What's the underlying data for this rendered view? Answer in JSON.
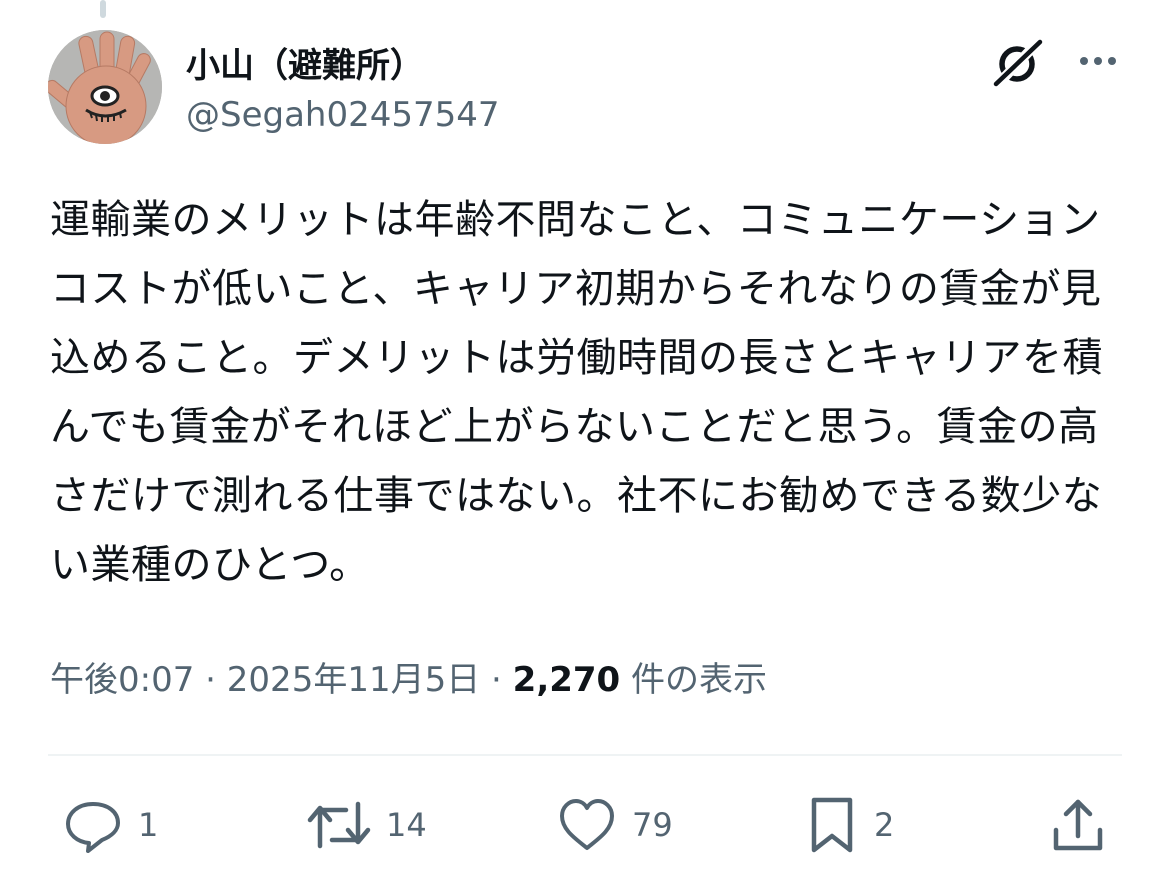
{
  "author": {
    "display_name": "小山（避難所）",
    "handle": "@Segah02457547"
  },
  "tweet": {
    "text": "運輸業のメリットは年齢不問なこと、コミュニケーションコストが低いこと、キャリア初期からそれなりの賃金が見込めること。デメリットは労働時間の長さとキャリアを積んでも賃金がそれほど上がらないことだと思う。賃金の高さだけで測れる仕事ではない。社不にお勧めできる数少ない業種のひとつ。"
  },
  "meta": {
    "time": "午後0:07",
    "sep1": "·",
    "date": "2025年11月5日",
    "sep2": "·",
    "views_count": "2,270",
    "views_label": "件の表示"
  },
  "actions": {
    "reply_count": "1",
    "retweet_count": "14",
    "like_count": "79",
    "bookmark_count": "2"
  },
  "icons": {
    "reply": "reply-icon",
    "retweet": "retweet-icon",
    "like": "heart-icon",
    "bookmark": "bookmark-icon",
    "share": "share-icon",
    "grok": "grok-icon",
    "more": "more-icon"
  },
  "colors": {
    "text": "#0f1419",
    "secondary": "#536471",
    "divider": "#eff3f4"
  }
}
